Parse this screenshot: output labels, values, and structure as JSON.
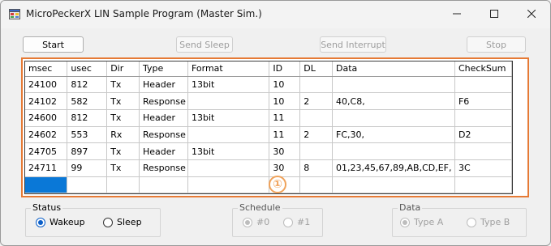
{
  "window": {
    "title": "MicroPeckerX LIN Sample Program (Master Sim.)"
  },
  "toolbar": {
    "start_label": "Start",
    "sleep_label": "Send Sleep",
    "interrupt_label": "Send Interrupt",
    "stop_label": "Stop"
  },
  "grid": {
    "columns": [
      "msec",
      "usec",
      "Dir",
      "Type",
      "Format",
      "ID",
      "DL",
      "Data",
      "CheckSum"
    ],
    "rows": [
      [
        "24100",
        "812",
        "Tx",
        "Header",
        "13bit",
        "10",
        "",
        "",
        ""
      ],
      [
        "24102",
        "582",
        "Tx",
        "Response",
        "",
        "10",
        "2",
        "40,C8,",
        "F6"
      ],
      [
        "24600",
        "812",
        "Tx",
        "Header",
        "13bit",
        "11",
        "",
        "",
        ""
      ],
      [
        "24602",
        "553",
        "Rx",
        "Response",
        "",
        "11",
        "2",
        "FC,30,",
        "D2"
      ],
      [
        "24705",
        "897",
        "Tx",
        "Header",
        "13bit",
        "30",
        "",
        "",
        ""
      ],
      [
        "24711",
        "99",
        "Tx",
        "Response",
        "",
        "30",
        "8",
        "01,23,45,67,89,AB,CD,EF,",
        "3C"
      ]
    ]
  },
  "marker": "①",
  "status": {
    "label": "Status",
    "options": [
      "Wakeup",
      "Sleep"
    ],
    "selected": "Wakeup"
  },
  "schedule": {
    "label": "Schedule",
    "options": [
      "#0",
      "#1"
    ],
    "selected": "#0"
  },
  "data": {
    "label": "Data",
    "options": [
      "Type A",
      "Type B"
    ],
    "selected": "Type A"
  },
  "colors": {
    "highlight": "#e67a35",
    "selection": "#0a78d7"
  }
}
